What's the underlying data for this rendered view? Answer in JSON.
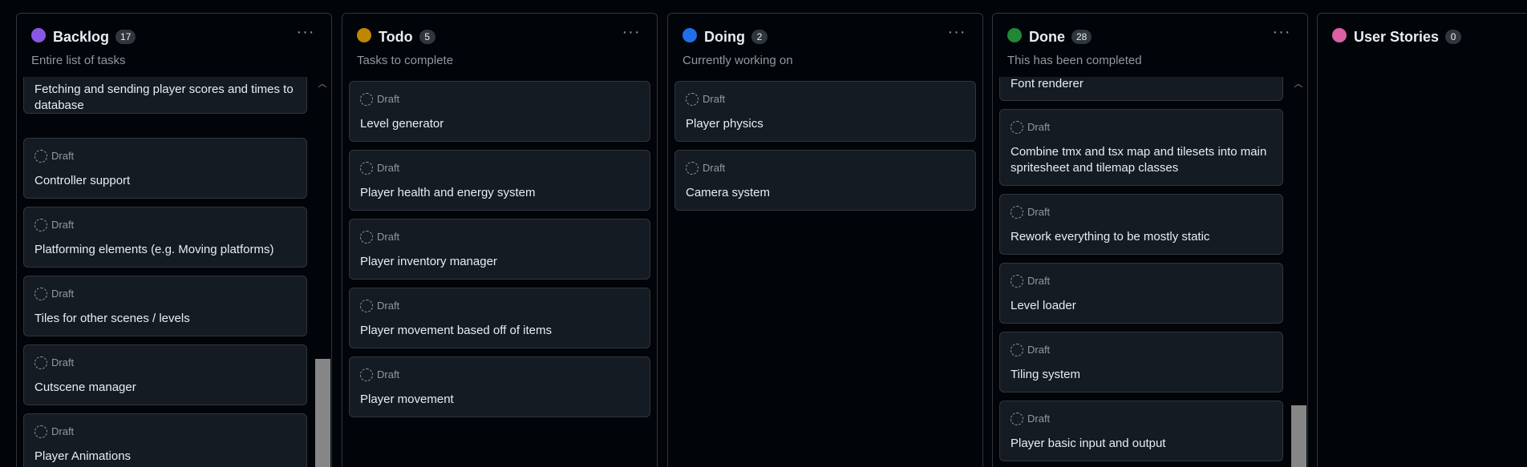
{
  "columns": [
    {
      "title": "Backlog",
      "count": "17",
      "description": "Entire list of tasks",
      "dot_color": "#8957e5",
      "menu": "···",
      "cards": [
        {
          "draft": "",
          "title": "Fetching and sending player scores and times to database"
        },
        {
          "draft": "Draft",
          "title": "Controller support"
        },
        {
          "draft": "Draft",
          "title": "Platforming elements (e.g. Moving platforms)"
        },
        {
          "draft": "Draft",
          "title": "Tiles for other scenes / levels"
        },
        {
          "draft": "Draft",
          "title": "Cutscene manager"
        },
        {
          "draft": "Draft",
          "title": "Player Animations"
        }
      ]
    },
    {
      "title": "Todo",
      "count": "5",
      "description": "Tasks to complete",
      "dot_color": "#bf8700",
      "menu": "···",
      "cards": [
        {
          "draft": "Draft",
          "title": "Level generator"
        },
        {
          "draft": "Draft",
          "title": "Player health and energy system"
        },
        {
          "draft": "Draft",
          "title": "Player inventory manager"
        },
        {
          "draft": "Draft",
          "title": "Player movement based off of items"
        },
        {
          "draft": "Draft",
          "title": "Player movement"
        }
      ]
    },
    {
      "title": "Doing",
      "count": "2",
      "description": "Currently working on",
      "dot_color": "#1f6feb",
      "menu": "···",
      "cards": [
        {
          "draft": "Draft",
          "title": "Player physics"
        },
        {
          "draft": "Draft",
          "title": "Camera system"
        }
      ]
    },
    {
      "title": "Done",
      "count": "28",
      "description": "This has been completed",
      "dot_color": "#238636",
      "menu": "···",
      "cards": [
        {
          "draft": "",
          "title": "Font renderer"
        },
        {
          "draft": "Draft",
          "title": "Combine tmx and tsx map and tilesets into main spritesheet and tilemap classes"
        },
        {
          "draft": "Draft",
          "title": "Rework everything to be mostly static"
        },
        {
          "draft": "Draft",
          "title": "Level loader"
        },
        {
          "draft": "Draft",
          "title": "Tiling system"
        },
        {
          "draft": "Draft",
          "title": "Player basic input and output"
        }
      ]
    },
    {
      "title": "User Stories",
      "count": "0",
      "description": "",
      "dot_color": "#db61a2",
      "menu": "",
      "cards": []
    }
  ],
  "scroll": {
    "up_glyph": "︿",
    "down_glyph": "﹀"
  }
}
